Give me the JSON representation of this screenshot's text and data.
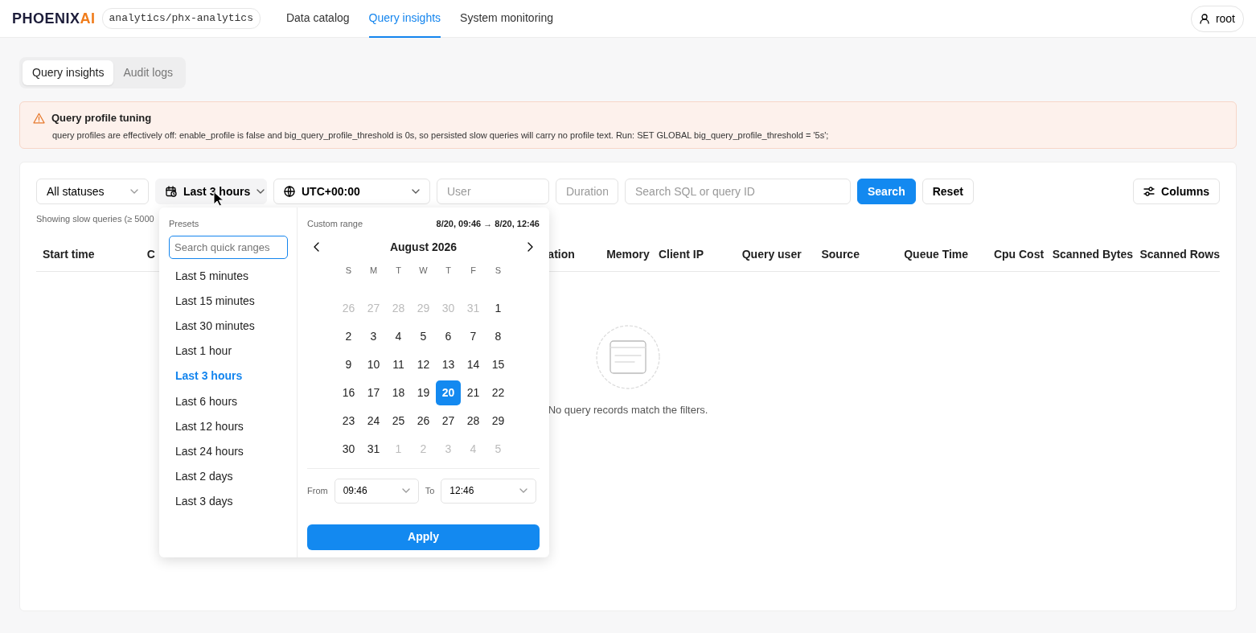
{
  "app": {
    "logo": "PHOENIX",
    "logo_accent": "AI",
    "workspace": "analytics/phx-analytics"
  },
  "nav": [
    {
      "label": "Data catalog",
      "selected": false
    },
    {
      "label": "Query insights",
      "selected": true
    },
    {
      "label": "System monitoring",
      "selected": false
    }
  ],
  "user": "root",
  "subtabs": [
    {
      "label": "Query insights",
      "selected": true
    },
    {
      "label": "Audit logs",
      "selected": false
    }
  ],
  "alert": {
    "title": "Query profile tuning",
    "message": "query profiles are effectively off: enable_profile is false and big_query_profile_threshold is 0s, so persisted slow queries will carry no profile text. Run: SET GLOBAL big_query_profile_threshold = '5s';"
  },
  "filters": {
    "status": "All statuses",
    "time_range": "Last 3 hours",
    "timezone": "UTC+00:00",
    "user_placeholder": "User",
    "duration_placeholder": "Duration",
    "search_placeholder": "Search SQL or query ID",
    "search_button": "Search",
    "reset_button": "Reset",
    "columns_button": "Columns"
  },
  "summary": "Showing slow queries (≥ 5000",
  "table": {
    "columns": [
      "Start time",
      "C",
      "ation",
      "Memory",
      "Client IP",
      "Query user",
      "Source",
      "Queue Time",
      "Cpu Cost",
      "Scanned Bytes",
      "Scanned Rows"
    ],
    "empty_text": "No query records match the filters."
  },
  "picker": {
    "presets_title": "Presets",
    "presets_placeholder": "Search quick ranges",
    "presets": [
      {
        "label": "Last 5 minutes",
        "selected": false
      },
      {
        "label": "Last 15 minutes",
        "selected": false
      },
      {
        "label": "Last 30 minutes",
        "selected": false
      },
      {
        "label": "Last 1 hour",
        "selected": false
      },
      {
        "label": "Last 3 hours",
        "selected": true
      },
      {
        "label": "Last 6 hours",
        "selected": false
      },
      {
        "label": "Last 12 hours",
        "selected": false
      },
      {
        "label": "Last 24 hours",
        "selected": false
      },
      {
        "label": "Last 2 days",
        "selected": false
      },
      {
        "label": "Last 3 days",
        "selected": false
      }
    ],
    "custom_title": "Custom range",
    "range_text": "8/20, 09:46 → 8/20, 12:46",
    "month": "August 2026",
    "weekdays": [
      "S",
      "M",
      "T",
      "W",
      "T",
      "F",
      "S"
    ],
    "weeks": [
      [
        {
          "day": "26",
          "outside": true,
          "selected": false
        },
        {
          "day": "27",
          "outside": true,
          "selected": false
        },
        {
          "day": "28",
          "outside": true,
          "selected": false
        },
        {
          "day": "29",
          "outside": true,
          "selected": false
        },
        {
          "day": "30",
          "outside": true,
          "selected": false
        },
        {
          "day": "31",
          "outside": true,
          "selected": false
        },
        {
          "day": "1",
          "outside": false,
          "selected": false
        }
      ],
      [
        {
          "day": "2",
          "outside": false,
          "selected": false
        },
        {
          "day": "3",
          "outside": false,
          "selected": false
        },
        {
          "day": "4",
          "outside": false,
          "selected": false
        },
        {
          "day": "5",
          "outside": false,
          "selected": false
        },
        {
          "day": "6",
          "outside": false,
          "selected": false
        },
        {
          "day": "7",
          "outside": false,
          "selected": false
        },
        {
          "day": "8",
          "outside": false,
          "selected": false
        }
      ],
      [
        {
          "day": "9",
          "outside": false,
          "selected": false
        },
        {
          "day": "10",
          "outside": false,
          "selected": false
        },
        {
          "day": "11",
          "outside": false,
          "selected": false
        },
        {
          "day": "12",
          "outside": false,
          "selected": false
        },
        {
          "day": "13",
          "outside": false,
          "selected": false
        },
        {
          "day": "14",
          "outside": false,
          "selected": false
        },
        {
          "day": "15",
          "outside": false,
          "selected": false
        }
      ],
      [
        {
          "day": "16",
          "outside": false,
          "selected": false
        },
        {
          "day": "17",
          "outside": false,
          "selected": false
        },
        {
          "day": "18",
          "outside": false,
          "selected": false
        },
        {
          "day": "19",
          "outside": false,
          "selected": false
        },
        {
          "day": "20",
          "outside": false,
          "selected": true
        },
        {
          "day": "21",
          "outside": false,
          "selected": false
        },
        {
          "day": "22",
          "outside": false,
          "selected": false
        }
      ],
      [
        {
          "day": "23",
          "outside": false,
          "selected": false
        },
        {
          "day": "24",
          "outside": false,
          "selected": false
        },
        {
          "day": "25",
          "outside": false,
          "selected": false
        },
        {
          "day": "26",
          "outside": false,
          "selected": false
        },
        {
          "day": "27",
          "outside": false,
          "selected": false
        },
        {
          "day": "28",
          "outside": false,
          "selected": false
        },
        {
          "day": "29",
          "outside": false,
          "selected": false
        }
      ],
      [
        {
          "day": "30",
          "outside": false,
          "selected": false
        },
        {
          "day": "31",
          "outside": false,
          "selected": false
        },
        {
          "day": "1",
          "outside": true,
          "selected": false
        },
        {
          "day": "2",
          "outside": true,
          "selected": false
        },
        {
          "day": "3",
          "outside": true,
          "selected": false
        },
        {
          "day": "4",
          "outside": true,
          "selected": false
        },
        {
          "day": "5",
          "outside": true,
          "selected": false
        }
      ]
    ],
    "from_label": "From",
    "from_value": "09:46",
    "to_label": "To",
    "to_value": "12:46",
    "apply_button": "Apply"
  }
}
